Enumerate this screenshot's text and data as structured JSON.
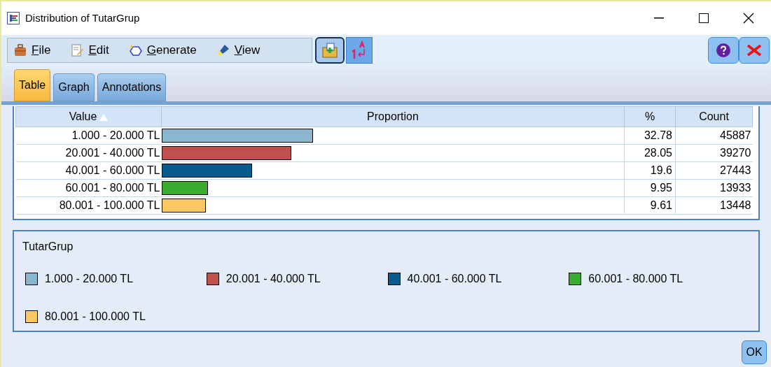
{
  "window": {
    "title": "Distribution of TutarGrup"
  },
  "menu": [
    {
      "mnemonic": "F",
      "rest": "ile",
      "kind": "file"
    },
    {
      "mnemonic": "E",
      "rest": "dit",
      "kind": "edit"
    },
    {
      "mnemonic": "G",
      "rest": "enerate",
      "kind": "generate"
    },
    {
      "mnemonic": "V",
      "rest": "iew",
      "kind": "view"
    }
  ],
  "tabs": [
    {
      "label": "Table",
      "selected": true
    },
    {
      "label": "Graph",
      "selected": false
    },
    {
      "label": "Annotations",
      "selected": false
    }
  ],
  "table": {
    "columns": [
      "Value",
      "Proportion",
      "%",
      "Count"
    ],
    "rows": [
      {
        "value": "1.000 - 20.000 TL",
        "level": 0.328,
        "color": "#8ab6cf",
        "percent": "32.78",
        "count": "45887"
      },
      {
        "value": "20.001 - 40.000 TL",
        "level": 0.281,
        "color": "#c0504d",
        "percent": "28.05",
        "count": "39270"
      },
      {
        "value": "40.001 - 60.000 TL",
        "level": 0.196,
        "color": "#0b5a8e",
        "percent": "19.6",
        "count": "27443"
      },
      {
        "value": "60.001 - 80.000 TL",
        "level": 0.1,
        "color": "#3aac2f",
        "percent": "9.95",
        "count": "13933"
      },
      {
        "value": "80.001 - 100.000 TL",
        "level": 0.096,
        "color": "#fdc861",
        "percent": "9.61",
        "count": "13448"
      }
    ]
  },
  "legend": {
    "title": "TutarGrup",
    "items": [
      {
        "label": "1.000 - 20.000 TL",
        "color": "#8ab6cf"
      },
      {
        "label": "20.001 - 40.000 TL",
        "color": "#c0504d"
      },
      {
        "label": "40.001 - 60.000 TL",
        "color": "#0b5a8e"
      },
      {
        "label": "60.001 - 80.000 TL",
        "color": "#3aac2f"
      },
      {
        "label": "80.001 - 100.000 TL",
        "color": "#fdc861"
      }
    ]
  },
  "ok_button": "OK"
}
